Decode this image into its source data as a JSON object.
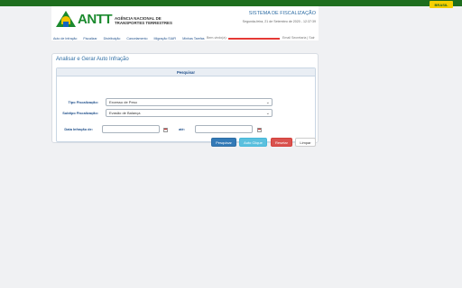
{
  "gov": {
    "badge": "BRASIL"
  },
  "header": {
    "logo": "ANTT",
    "agency_line1": "AGÊNCIA NACIONAL DE",
    "agency_line2": "TRANSPORTES TERRESTRES",
    "system_title": "SISTEMA DE FISCALIZAÇÃO",
    "date": "Segunda-feira, 21 de Setembro de 2020 - 12:37:39"
  },
  "nav": {
    "items": [
      "Auto de Infração",
      "Fiscalizar",
      "Distribuição",
      "Cancelamento",
      "Migração SIAFI",
      "Minhas Tarefas"
    ],
    "welcome": "Bem-vindo(a):",
    "links": "Email Secretaria | Sair"
  },
  "panel": {
    "title": "Analisar e Gerar Auto Infração",
    "search_header": "Pesquisar",
    "tipo_label": "Tipo Fiscalização:",
    "tipo_value": "Excesso de Peso",
    "subtipo_label": "Subtipo Fiscalização:",
    "subtipo_value": "Evasão de Balança",
    "data_label": "Data Infração de:",
    "ate_label": "até:",
    "buttons": {
      "pesquisar": "Pesquisar",
      "auto_clique": "Auto Clique",
      "resetar": "Resetar",
      "limpar": "Limpar"
    }
  }
}
